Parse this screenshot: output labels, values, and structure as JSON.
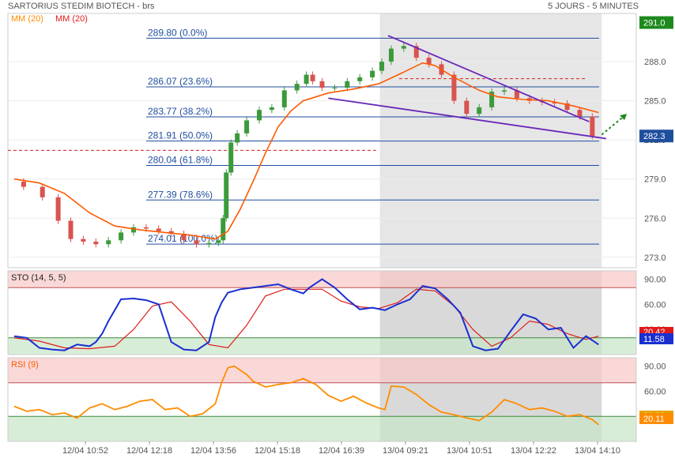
{
  "header": {
    "title": "SARTORIUS STEDIM BIOTECH - brs",
    "period": "5 JOURS - 5 MINUTES",
    "ma_label_1": "MM (20)",
    "ma_label_2": "MM (20)"
  },
  "colors": {
    "up": "#3b9a3b",
    "down": "#d9534f",
    "ma": "#ff5a00",
    "fib": "#1f4e9e",
    "fib_text": "#1f4e9e",
    "trend": "#6a28b8",
    "sto_k": "#1a2fd0",
    "sto_d": "#e01a1a",
    "rsi": "#ff8c00",
    "last_tag": "#1f4e9e",
    "high_tag": "#1e8a1e"
  },
  "chart_data": {
    "type": "line",
    "title": "SARTORIUS STEDIM BIOTECH - brs",
    "timeframe": "5 JOURS - 5 MINUTES",
    "x_tick_labels": [
      "12/04 10:52",
      "12/04 12:18",
      "12/04 13:56",
      "12/04 15:18",
      "12/04 16:39",
      "13/04 09:21",
      "13/04 10:51",
      "13/04 12:22",
      "13/04 14:10"
    ],
    "price_axis": {
      "ticks": [
        273.0,
        276.0,
        279.0,
        282.0,
        285.0,
        288.0
      ],
      "ylim": [
        272.2,
        291.7
      ]
    },
    "price_tags": {
      "high": "291.0",
      "last": "282.3"
    },
    "fibonacci_levels": [
      {
        "label": "289.80  (0.0%)",
        "value": 289.8
      },
      {
        "label": "286.07  (23.6%)",
        "value": 286.07
      },
      {
        "label": "283.77  (38.2%)",
        "value": 283.77
      },
      {
        "label": "281.91  (50.0%)",
        "value": 281.91
      },
      {
        "label": "280.04  (61.8%)",
        "value": 280.04
      },
      {
        "label": "277.39  (78.6%)",
        "value": 277.39
      },
      {
        "label": "274.01  (100.0%)",
        "value": 274.01
      }
    ],
    "dashed_levels": [
      281.2,
      286.7
    ],
    "trendlines": [
      {
        "x": [
          0.605,
          0.925
        ],
        "y": [
          290.0,
          283.4
        ]
      },
      {
        "x": [
          0.51,
          0.952
        ],
        "y": [
          285.2,
          282.1
        ]
      }
    ],
    "price_series": {
      "name": "close",
      "x": [
        0.01,
        0.04,
        0.07,
        0.09,
        0.11,
        0.13,
        0.15,
        0.17,
        0.19,
        0.21,
        0.23,
        0.25,
        0.27,
        0.29,
        0.31,
        0.33,
        0.34,
        0.345,
        0.35,
        0.36,
        0.37,
        0.39,
        0.41,
        0.43,
        0.45,
        0.47,
        0.48,
        0.49,
        0.51,
        0.53,
        0.55,
        0.57,
        0.59,
        0.6,
        0.62,
        0.64,
        0.66,
        0.68,
        0.7,
        0.72,
        0.74,
        0.76,
        0.78,
        0.8,
        0.82,
        0.84,
        0.86,
        0.88,
        0.9,
        0.92,
        0.94
      ],
      "y": [
        278.8,
        278.4,
        277.6,
        275.8,
        274.4,
        274.2,
        274.0,
        274.3,
        274.9,
        275.3,
        275.2,
        275.0,
        274.8,
        274.3,
        274.0,
        274.1,
        274.3,
        276.0,
        279.5,
        281.8,
        282.5,
        283.5,
        284.3,
        284.5,
        285.8,
        286.3,
        287.0,
        286.5,
        286.0,
        286.0,
        286.5,
        286.8,
        287.3,
        288.0,
        289.0,
        289.2,
        288.3,
        287.8,
        287.0,
        285.0,
        284.0,
        284.5,
        285.7,
        285.8,
        285.2,
        285.0,
        284.9,
        284.8,
        284.3,
        283.8,
        282.3
      ]
    },
    "ma_series": {
      "name": "MM (20)",
      "x": [
        0.01,
        0.05,
        0.09,
        0.13,
        0.17,
        0.21,
        0.25,
        0.29,
        0.33,
        0.35,
        0.37,
        0.39,
        0.41,
        0.43,
        0.45,
        0.47,
        0.49,
        0.51,
        0.55,
        0.59,
        0.63,
        0.66,
        0.68,
        0.71,
        0.75,
        0.78,
        0.82,
        0.86,
        0.9,
        0.94
      ],
      "y": [
        279.0,
        278.7,
        277.9,
        276.4,
        275.4,
        275.1,
        274.9,
        274.7,
        274.4,
        275.0,
        276.7,
        278.8,
        281.0,
        283.0,
        284.2,
        285.0,
        285.3,
        285.6,
        285.9,
        286.3,
        287.2,
        287.9,
        287.7,
        286.8,
        285.8,
        285.3,
        285.1,
        285.0,
        284.6,
        284.1
      ]
    },
    "shaded_session": {
      "from": 0.592,
      "to": 0.945
    },
    "projection_arrow": {
      "x": [
        0.945,
        0.985
      ],
      "y": [
        282.4,
        284.0
      ]
    },
    "stochastic": {
      "label": "STO (14, 5, 5)",
      "ylim": [
        0,
        100
      ],
      "ticks": [
        90,
        60,
        30
      ],
      "overbought": 80,
      "oversold": 20,
      "tags": {
        "d": "20.42",
        "k": "11.58"
      },
      "k": {
        "name": "%K",
        "x": [
          0.01,
          0.03,
          0.05,
          0.07,
          0.09,
          0.11,
          0.13,
          0.14,
          0.15,
          0.16,
          0.18,
          0.2,
          0.22,
          0.24,
          0.26,
          0.28,
          0.3,
          0.32,
          0.33,
          0.34,
          0.35,
          0.37,
          0.39,
          0.41,
          0.43,
          0.45,
          0.47,
          0.48,
          0.5,
          0.52,
          0.54,
          0.56,
          0.58,
          0.6,
          0.62,
          0.64,
          0.66,
          0.68,
          0.7,
          0.72,
          0.74,
          0.76,
          0.78,
          0.8,
          0.82,
          0.84,
          0.86,
          0.88,
          0.9,
          0.92,
          0.94
        ],
        "y": [
          22,
          20,
          8,
          6,
          5,
          12,
          10,
          15,
          25,
          40,
          66,
          67,
          65,
          60,
          15,
          6,
          5,
          15,
          45,
          62,
          74,
          78,
          80,
          82,
          84,
          78,
          73,
          80,
          90,
          80,
          66,
          54,
          56,
          53,
          60,
          66,
          82,
          79,
          66,
          50,
          10,
          5,
          7,
          28,
          48,
          43,
          30,
          32,
          8,
          22,
          12
        ]
      },
      "d": {
        "name": "%D",
        "x": [
          0.01,
          0.05,
          0.09,
          0.13,
          0.17,
          0.2,
          0.23,
          0.26,
          0.29,
          0.32,
          0.35,
          0.38,
          0.41,
          0.44,
          0.47,
          0.5,
          0.53,
          0.56,
          0.59,
          0.62,
          0.65,
          0.68,
          0.71,
          0.74,
          0.77,
          0.8,
          0.83,
          0.86,
          0.89,
          0.92,
          0.94
        ],
        "y": [
          20,
          16,
          8,
          7,
          10,
          30,
          58,
          63,
          40,
          12,
          8,
          35,
          70,
          78,
          78,
          78,
          64,
          57,
          55,
          62,
          78,
          76,
          58,
          30,
          10,
          20,
          40,
          36,
          25,
          18,
          22
        ]
      }
    },
    "rsi": {
      "label": "RSI (9)",
      "ylim": [
        0,
        100
      ],
      "ticks": [
        90,
        60,
        30
      ],
      "overbought": 70,
      "oversold": 30,
      "tags": {
        "prev": "30.00",
        "last": "20.11"
      },
      "series": {
        "name": "RSI (9)",
        "x": [
          0.01,
          0.03,
          0.05,
          0.07,
          0.09,
          0.11,
          0.13,
          0.15,
          0.17,
          0.19,
          0.21,
          0.23,
          0.25,
          0.27,
          0.29,
          0.31,
          0.33,
          0.34,
          0.35,
          0.36,
          0.37,
          0.38,
          0.39,
          0.41,
          0.43,
          0.45,
          0.47,
          0.49,
          0.51,
          0.53,
          0.55,
          0.57,
          0.59,
          0.6,
          0.61,
          0.63,
          0.65,
          0.67,
          0.69,
          0.71,
          0.73,
          0.75,
          0.77,
          0.79,
          0.81,
          0.83,
          0.85,
          0.87,
          0.89,
          0.91,
          0.93,
          0.94
        ],
        "y": [
          42,
          36,
          38,
          32,
          34,
          28,
          40,
          45,
          38,
          42,
          48,
          50,
          38,
          40,
          30,
          33,
          45,
          70,
          88,
          90,
          85,
          80,
          72,
          65,
          68,
          70,
          75,
          68,
          55,
          48,
          54,
          46,
          40,
          38,
          66,
          65,
          56,
          44,
          35,
          32,
          28,
          25,
          35,
          50,
          45,
          38,
          40,
          36,
          30,
          32,
          26,
          20
        ]
      }
    }
  }
}
